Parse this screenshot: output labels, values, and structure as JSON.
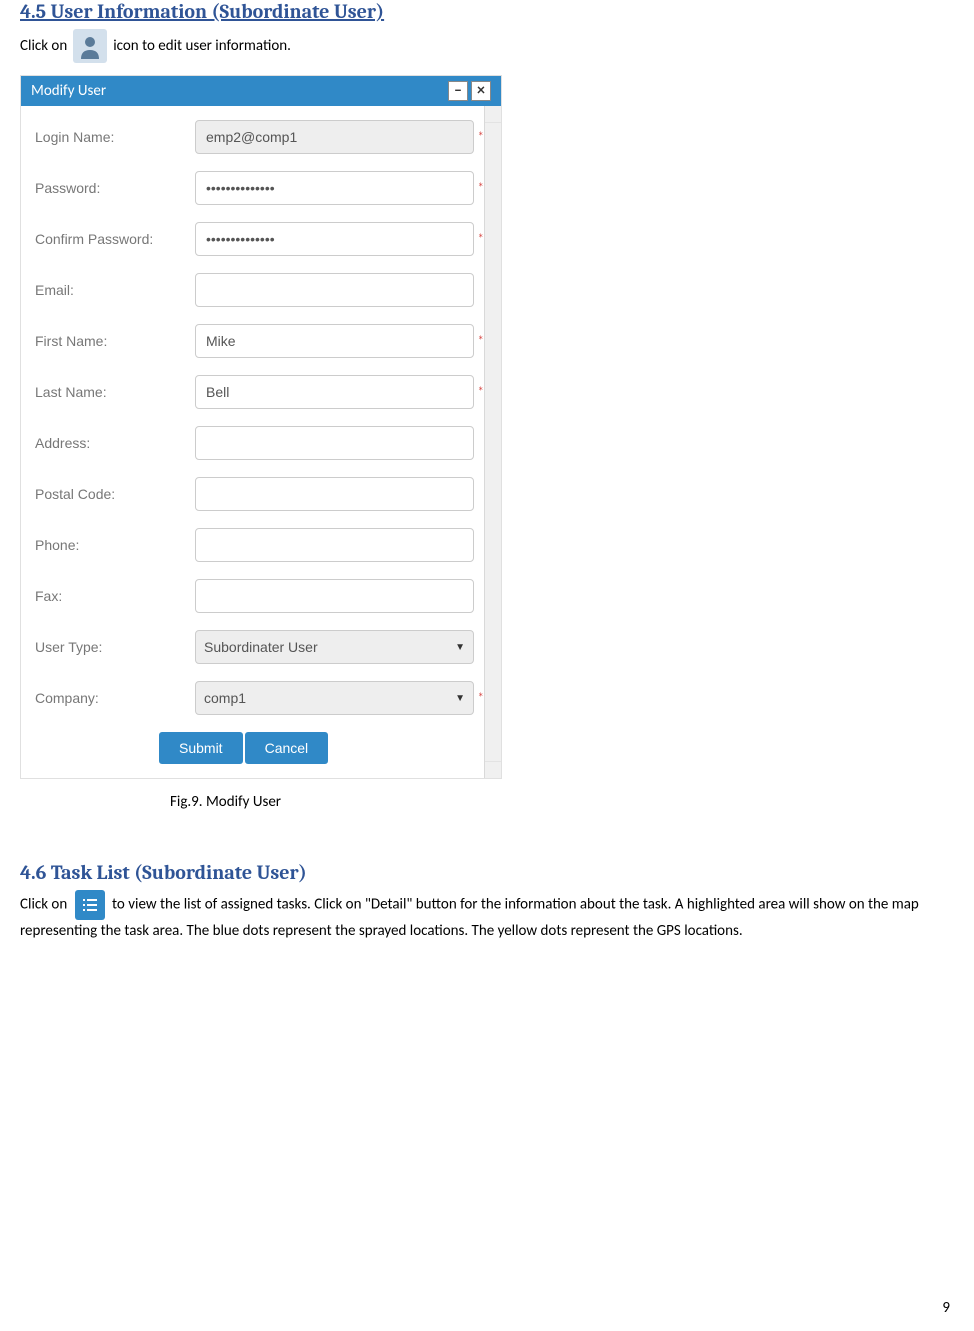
{
  "section45": {
    "heading": "4.5 User Information (Subordinate User)",
    "text_before": "Click on",
    "text_after": "icon to edit user information."
  },
  "dialog": {
    "title": "Modify User",
    "minimize": "–",
    "close": "×",
    "fields": {
      "login_name": {
        "label": "Login Name:",
        "value": "emp2@comp1",
        "required": true,
        "disabled": true
      },
      "password": {
        "label": "Password:",
        "value": "••••••••••••••",
        "required": true
      },
      "confirm_password": {
        "label": "Confirm Password:",
        "value": "••••••••••••••",
        "required": true
      },
      "email": {
        "label": "Email:",
        "value": "",
        "required": false
      },
      "first_name": {
        "label": "First Name:",
        "value": "Mike",
        "required": true
      },
      "last_name": {
        "label": "Last Name:",
        "value": "Bell",
        "required": true
      },
      "address": {
        "label": "Address:",
        "value": "",
        "required": false
      },
      "postal_code": {
        "label": "Postal Code:",
        "value": "",
        "required": false
      },
      "phone": {
        "label": "Phone:",
        "value": "",
        "required": false
      },
      "fax": {
        "label": "Fax:",
        "value": "",
        "required": false
      },
      "user_type": {
        "label": "User Type:",
        "value": "Subordinater User",
        "required": false,
        "type": "select"
      },
      "company": {
        "label": "Company:",
        "value": "comp1",
        "required": true,
        "type": "select"
      }
    },
    "submit_label": "Submit",
    "cancel_label": "Cancel"
  },
  "figure_caption": "Fig.9. Modify User",
  "section46": {
    "heading": "4.6 Task List (Subordinate User)",
    "text_before": "Click on",
    "text_after": "to view the list of assigned tasks. Click on \"Detail\" button for the information about the task.  A highlighted area will show on the map representing the task area. The blue dots represent the sprayed locations. The yellow dots represent the GPS locations."
  },
  "page_number": "9",
  "required_marker": "*"
}
